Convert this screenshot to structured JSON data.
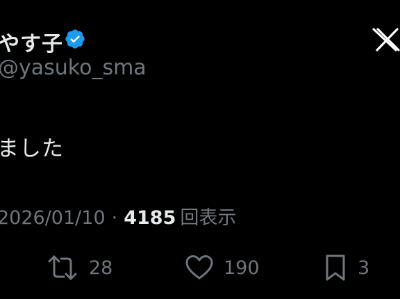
{
  "author": {
    "display_name": "やす子",
    "handle": "@yasuko_sma",
    "verified": true
  },
  "tweet": {
    "text": "ました"
  },
  "meta": {
    "date": "2026/01/10",
    "separator": "·",
    "views_count": "4185",
    "views_label": "回表示"
  },
  "actions": {
    "retweet_count": "28",
    "like_count": "190",
    "bookmark_count": "3"
  },
  "icons": {
    "verified": "verified-badge-icon",
    "brand": "x-logo-icon",
    "retweet": "retweet-icon",
    "like": "heart-icon",
    "bookmark": "bookmark-icon"
  },
  "colors": {
    "background": "#000000",
    "primary_text": "#e7e9ea",
    "secondary_text": "#71767b",
    "verified_blue": "#1d9bf0"
  }
}
